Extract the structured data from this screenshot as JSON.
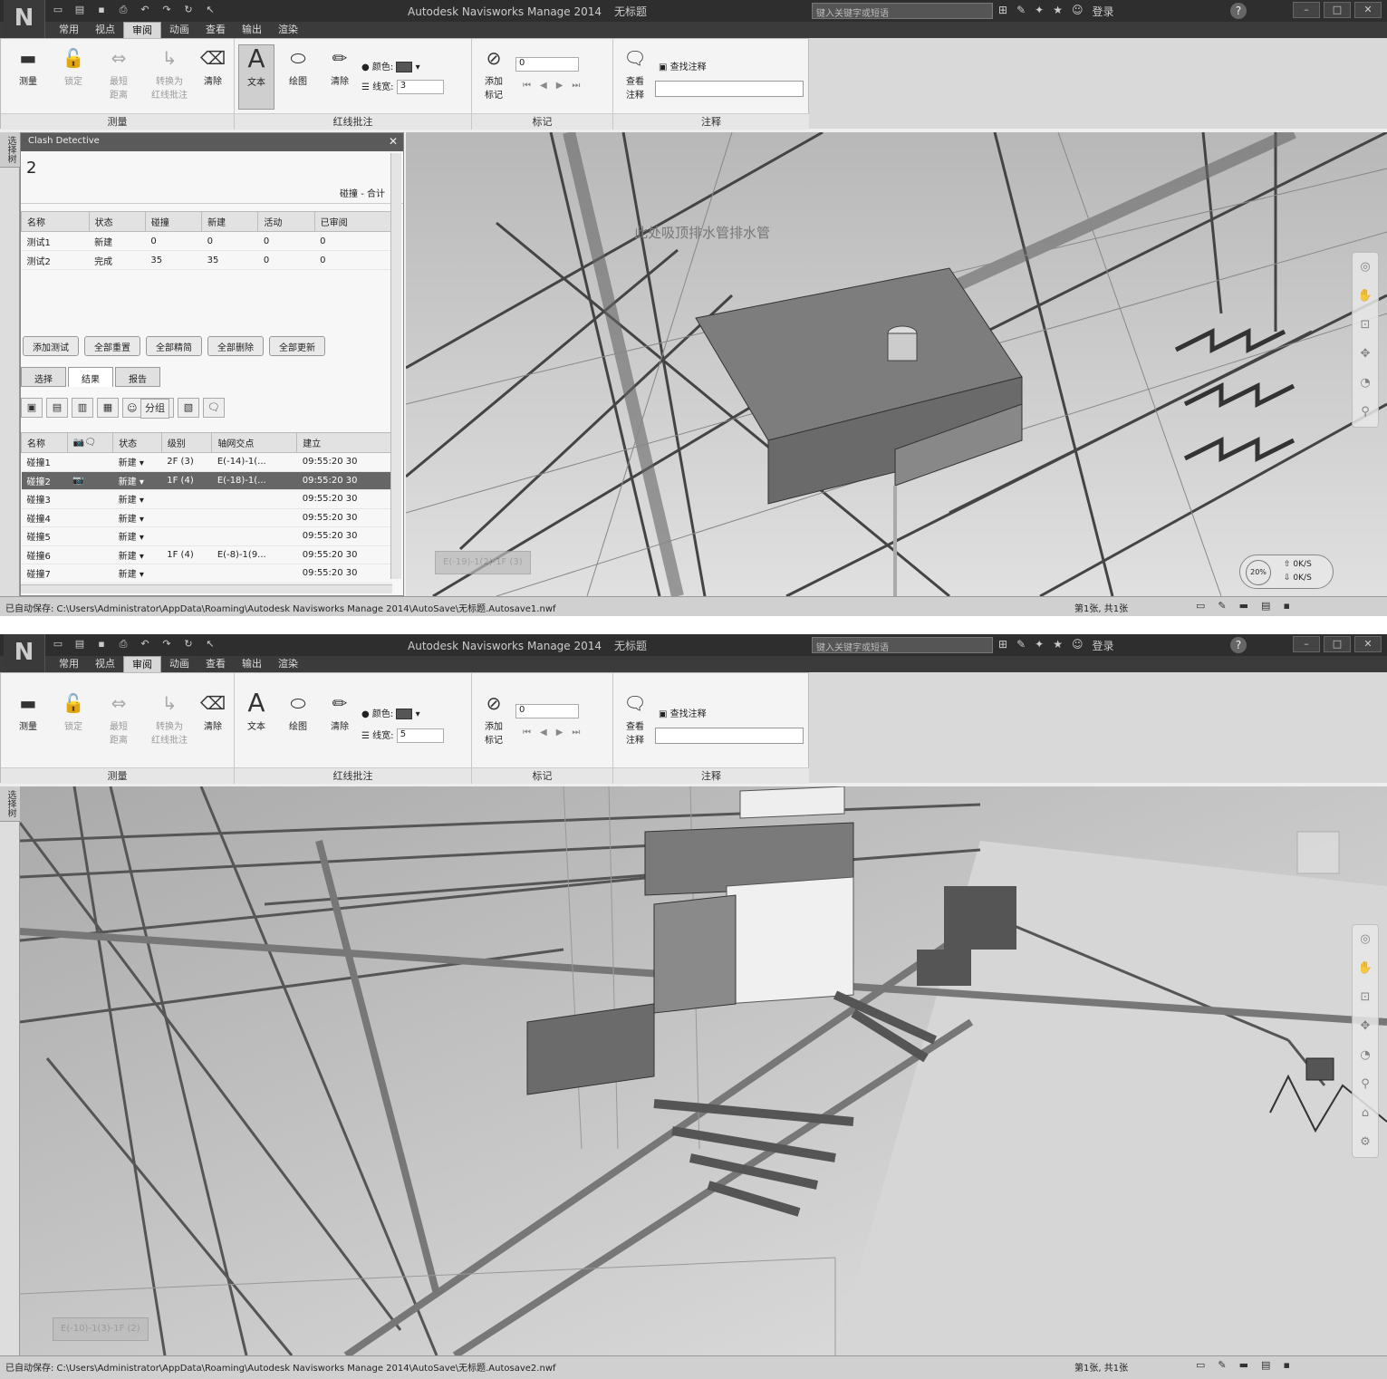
{
  "app": {
    "title": "Autodesk Navisworks Manage 2014",
    "doc_title": "无标题",
    "logo_glyph": "N",
    "search_placeholder": "键入关键字或短语",
    "login": "登录",
    "help": "?"
  },
  "menu_tabs": [
    "常用",
    "视点",
    "审阅",
    "动画",
    "查看",
    "输出",
    "渲染"
  ],
  "active_tab": "审阅",
  "ribbon": {
    "measure": {
      "group_label": "测量",
      "buttons": [
        {
          "label": "测量",
          "enabled": true
        },
        {
          "label": "锁定",
          "enabled": false
        },
        {
          "label": "最短\n距离",
          "enabled": false
        },
        {
          "label": "转换为\n红线批注",
          "enabled": false
        },
        {
          "label": "清除",
          "enabled": true
        }
      ]
    },
    "redline": {
      "group_label": "红线批注",
      "text_label": "文本",
      "draw_label": "绘图",
      "erase_label": "清除",
      "color_label": "颜色:",
      "linewidth_label": "线宽:"
    },
    "tags": {
      "group_label": "标记",
      "add_tag_label": "添加\n标记",
      "tag_value": "0"
    },
    "comments": {
      "group_label": "注释",
      "view_comments_label": "查看\n注释",
      "find_comments_label": "查找注释"
    }
  },
  "window1": {
    "linewidth_value": "3",
    "clash_panel": {
      "title": "Clash Detective",
      "current_test": "2",
      "meta": "碰撞 - 合计",
      "test_columns": [
        "名称",
        "状态",
        "碰撞",
        "新建",
        "活动",
        "已审阅"
      ],
      "tests": [
        [
          "测试1",
          "新建",
          "0",
          "0",
          "0",
          "0"
        ],
        [
          "测试2",
          "完成",
          "35",
          "35",
          "0",
          "0"
        ]
      ],
      "buttons": [
        "添加测试",
        "全部重置",
        "全部精简",
        "全部删除",
        "全部更新"
      ],
      "tabs": [
        "选择",
        "结果",
        "报告"
      ],
      "active_tab": "结果",
      "group_button": "分组",
      "result_columns": [
        "名称",
        "",
        "状态",
        "级别",
        "轴网交点",
        "建立"
      ],
      "results": [
        [
          "碰撞1",
          "",
          "新建",
          "2F (3)",
          "E(-14)-1(...",
          "09:55:20 30"
        ],
        [
          "碰撞2",
          "📷",
          "新建",
          "1F (4)",
          "E(-18)-1(...",
          "09:55:20 30"
        ],
        [
          "碰撞3",
          "",
          "新建",
          "",
          "",
          "09:55:20 30"
        ],
        [
          "碰撞4",
          "",
          "新建",
          "",
          "",
          "09:55:20 30"
        ],
        [
          "碰撞5",
          "",
          "新建",
          "",
          "",
          "09:55:20 30"
        ],
        [
          "碰撞6",
          "",
          "新建",
          "1F (4)",
          "E(-8)-1(9...",
          "09:55:20 30"
        ],
        [
          "碰撞7",
          "",
          "新建",
          "",
          "",
          "09:55:20 30"
        ]
      ],
      "selected_result_index": 1
    },
    "viewport_annotation": "此处吸顶排水管排水管",
    "viewport_tag": "E(-19)-1(2)-1F (3)",
    "speed": {
      "percent": "20%",
      "up": "0K/S",
      "down": "0K/S"
    },
    "status": "已自动保存: C:\\Users\\Administrator\\AppData\\Roaming\\Autodesk Navisworks Manage 2014\\AutoSave\\无标题.Autosave1.nwf",
    "page_info": "第1张, 共1张"
  },
  "window2": {
    "linewidth_value": "5",
    "viewport_tag": "E(-10)-1(3)-1F (2)",
    "status": "已自动保存: C:\\Users\\Administrator\\AppData\\Roaming\\Autodesk Navisworks Manage 2014\\AutoSave\\无标题.Autosave2.nwf",
    "page_info": "第1张, 共1张"
  },
  "side_strip_label": "选择树",
  "colors": {
    "titlebar": "#2e2e2e",
    "ribbon": "#f4f4f4",
    "viewport": "#cfcfcf",
    "selected_row": "#666666"
  }
}
